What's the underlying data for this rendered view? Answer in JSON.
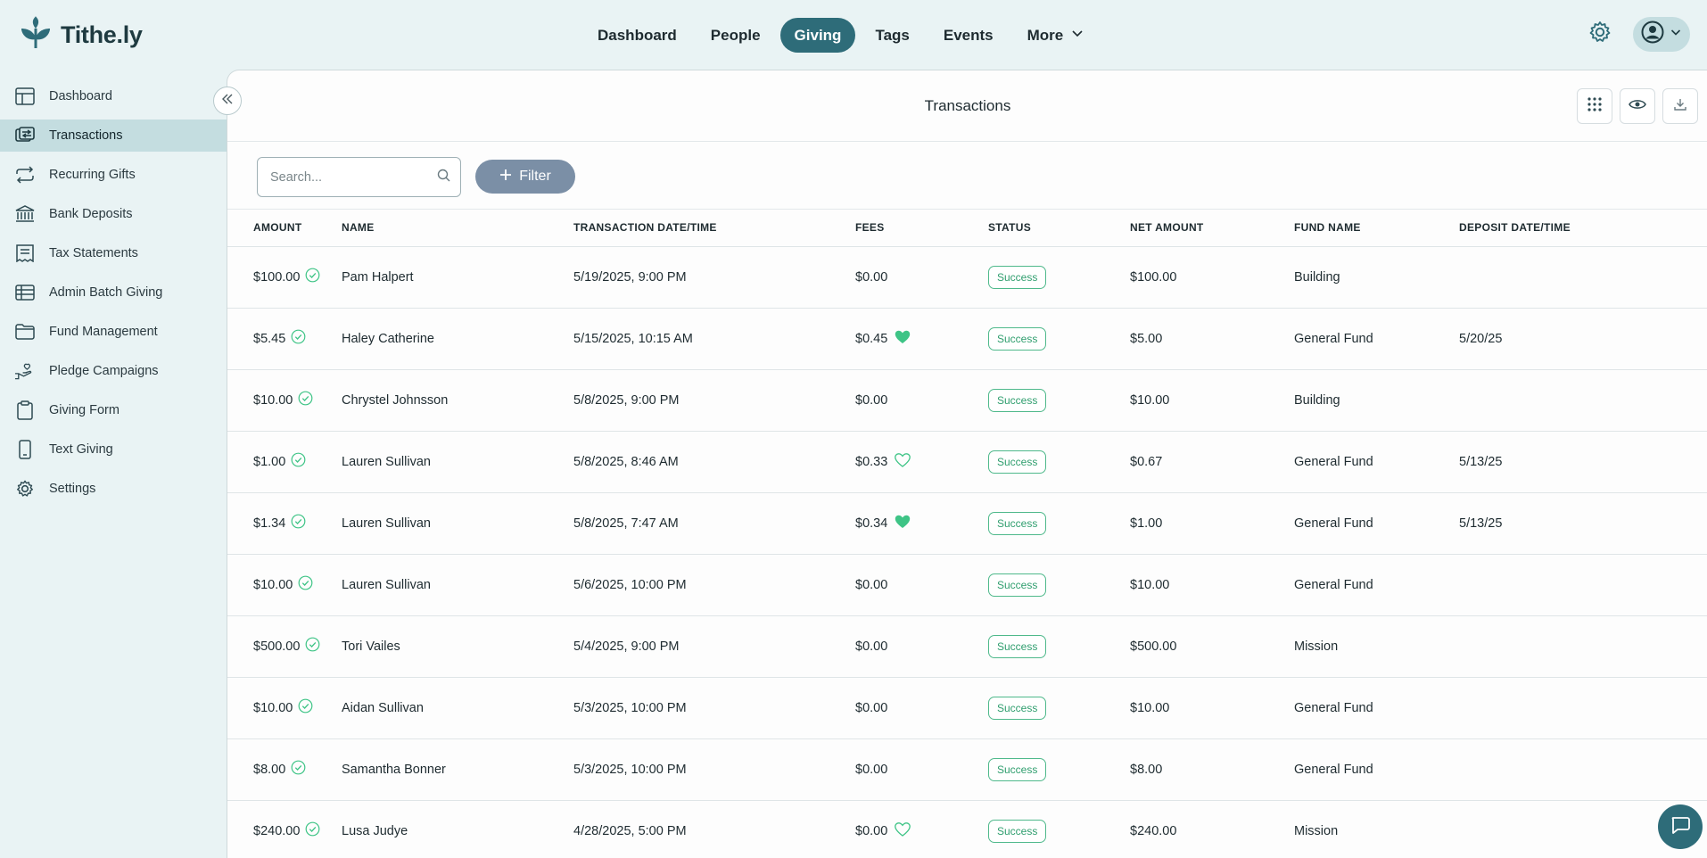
{
  "brand": {
    "name": "Tithe.ly"
  },
  "nav": {
    "items": [
      {
        "label": "Dashboard",
        "active": false
      },
      {
        "label": "People",
        "active": false
      },
      {
        "label": "Giving",
        "active": true
      },
      {
        "label": "Tags",
        "active": false
      },
      {
        "label": "Events",
        "active": false
      },
      {
        "label": "More",
        "active": false
      }
    ]
  },
  "sidebar": {
    "items": [
      {
        "label": "Dashboard",
        "icon": "layout-icon"
      },
      {
        "label": "Transactions",
        "icon": "transfer-icon",
        "active": true
      },
      {
        "label": "Recurring Gifts",
        "icon": "repeat-icon"
      },
      {
        "label": "Bank Deposits",
        "icon": "bank-icon"
      },
      {
        "label": "Tax Statements",
        "icon": "receipt-icon"
      },
      {
        "label": "Admin Batch Giving",
        "icon": "table-icon"
      },
      {
        "label": "Fund Management",
        "icon": "folder-icon"
      },
      {
        "label": "Pledge Campaigns",
        "icon": "hand-heart-icon"
      },
      {
        "label": "Giving Form",
        "icon": "clipboard-icon"
      },
      {
        "label": "Text Giving",
        "icon": "phone-icon"
      },
      {
        "label": "Settings",
        "icon": "gear-icon"
      }
    ]
  },
  "main": {
    "title": "Transactions",
    "search_placeholder": "Search...",
    "filter_label": "Filter"
  },
  "table": {
    "columns": [
      "AMOUNT",
      "NAME",
      "TRANSACTION DATE/TIME",
      "FEES",
      "STATUS",
      "NET AMOUNT",
      "FUND NAME",
      "DEPOSIT DATE/TIME"
    ],
    "rows": [
      {
        "amount": "$100.00",
        "name": "Pam Halpert",
        "date": "5/19/2025, 9:00 PM",
        "fees": "$0.00",
        "fee_heart": "none",
        "status": "Success",
        "net": "$100.00",
        "fund": "Building",
        "deposit": ""
      },
      {
        "amount": "$5.45",
        "name": "Haley Catherine",
        "date": "5/15/2025, 10:15 AM",
        "fees": "$0.45",
        "fee_heart": "filled",
        "status": "Success",
        "net": "$5.00",
        "fund": "General Fund",
        "deposit": "5/20/25"
      },
      {
        "amount": "$10.00",
        "name": "Chrystel Johnsson",
        "date": "5/8/2025, 9:00 PM",
        "fees": "$0.00",
        "fee_heart": "none",
        "status": "Success",
        "net": "$10.00",
        "fund": "Building",
        "deposit": ""
      },
      {
        "amount": "$1.00",
        "name": "Lauren Sullivan",
        "date": "5/8/2025, 8:46 AM",
        "fees": "$0.33",
        "fee_heart": "outline",
        "status": "Success",
        "net": "$0.67",
        "fund": "General Fund",
        "deposit": "5/13/25"
      },
      {
        "amount": "$1.34",
        "name": "Lauren Sullivan",
        "date": "5/8/2025, 7:47 AM",
        "fees": "$0.34",
        "fee_heart": "filled",
        "status": "Success",
        "net": "$1.00",
        "fund": "General Fund",
        "deposit": "5/13/25"
      },
      {
        "amount": "$10.00",
        "name": "Lauren Sullivan",
        "date": "5/6/2025, 10:00 PM",
        "fees": "$0.00",
        "fee_heart": "none",
        "status": "Success",
        "net": "$10.00",
        "fund": "General Fund",
        "deposit": ""
      },
      {
        "amount": "$500.00",
        "name": "Tori Vailes",
        "date": "5/4/2025, 9:00 PM",
        "fees": "$0.00",
        "fee_heart": "none",
        "status": "Success",
        "net": "$500.00",
        "fund": "Mission",
        "deposit": ""
      },
      {
        "amount": "$10.00",
        "name": "Aidan Sullivan",
        "date": "5/3/2025, 10:00 PM",
        "fees": "$0.00",
        "fee_heart": "none",
        "status": "Success",
        "net": "$10.00",
        "fund": "General Fund",
        "deposit": ""
      },
      {
        "amount": "$8.00",
        "name": "Samantha Bonner",
        "date": "5/3/2025, 10:00 PM",
        "fees": "$0.00",
        "fee_heart": "none",
        "status": "Success",
        "net": "$8.00",
        "fund": "General Fund",
        "deposit": ""
      },
      {
        "amount": "$240.00",
        "name": "Lusa Judye",
        "date": "4/28/2025, 5:00 PM",
        "fees": "$0.00",
        "fee_heart": "outline",
        "status": "Success",
        "net": "$240.00",
        "fund": "Mission",
        "deposit": ""
      }
    ]
  },
  "colors": {
    "accent": "#2e6c79",
    "success": "#2f9e6e",
    "heart": "#3ec486",
    "sidebar_active": "#c4dde0",
    "background": "#e9f3f4"
  }
}
